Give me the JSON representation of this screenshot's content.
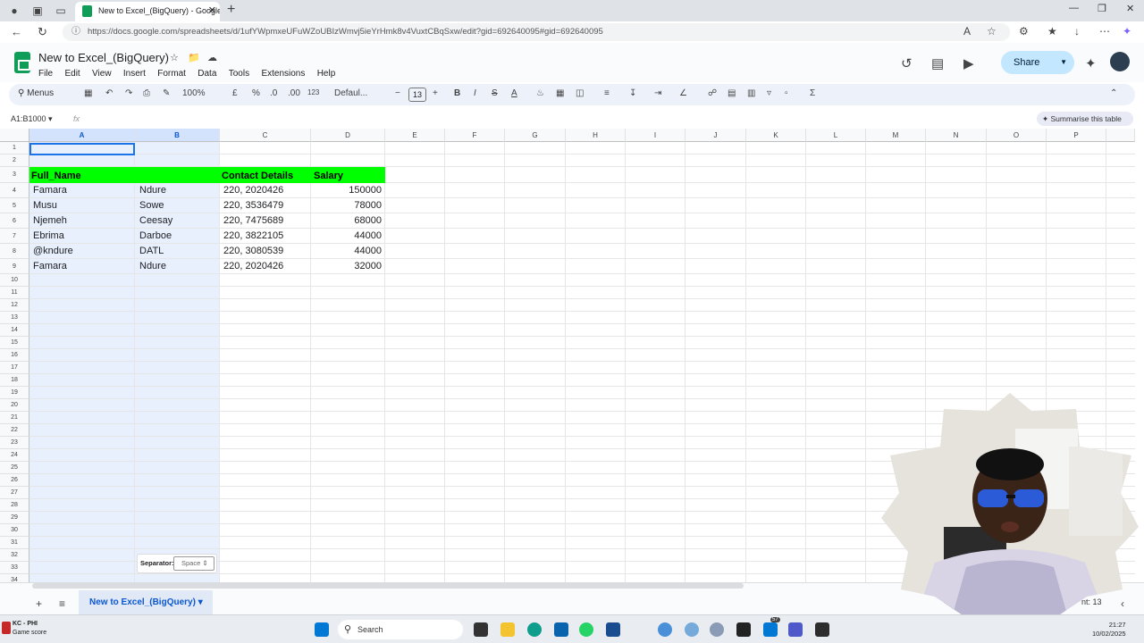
{
  "browser": {
    "tab_title": "New to Excel_(BigQuery) - Google",
    "url": "https://docs.google.com/spreadsheets/d/1ufYWpmxeUFuWZoUBIzWmvj5ieYrHmk8v4VuxtCBqSxw/edit?gid=692640095#gid=692640095"
  },
  "doc": {
    "title": "New to Excel_(BigQuery)",
    "menus": [
      "File",
      "Edit",
      "View",
      "Insert",
      "Format",
      "Data",
      "Tools",
      "Extensions",
      "Help"
    ],
    "share_label": "Share"
  },
  "toolbar": {
    "menus_label": "Menus",
    "zoom": "100%",
    "currency": "£",
    "percent": "%",
    "dec_dec": ".0",
    "dec_inc": ".00",
    "number_format": "123",
    "font": "Defaul...",
    "font_size": "13"
  },
  "formula_bar": {
    "name_box": "A1:B1000",
    "fx": "fx",
    "summarise": "Summarise this table"
  },
  "grid": {
    "columns": [
      "A",
      "B",
      "C",
      "D",
      "E",
      "F",
      "G",
      "H",
      "I",
      "J",
      "K",
      "L",
      "M",
      "N",
      "O",
      "P"
    ],
    "rows": [
      "1",
      "2",
      "3",
      "4",
      "5",
      "6",
      "7",
      "8",
      "9",
      "10",
      "11",
      "12",
      "13",
      "14",
      "15",
      "16",
      "17",
      "18",
      "19",
      "20",
      "21",
      "22",
      "23",
      "24",
      "25",
      "26",
      "27",
      "28",
      "29",
      "30",
      "31",
      "32",
      "33",
      "34"
    ],
    "headers": [
      "Full_Name",
      "Contact Details",
      "Salary"
    ],
    "data": [
      [
        "Famara",
        "Ndure",
        "220, 2020426",
        "150000"
      ],
      [
        "Musu",
        "Sowe",
        "220, 3536479",
        "78000"
      ],
      [
        "Njemeh",
        "Ceesay",
        "220, 7475689",
        "68000"
      ],
      [
        "Ebrima",
        "Darboe",
        "220, 3822105",
        "44000"
      ],
      [
        "@kndure",
        "DATL",
        "220, 3080539",
        "44000"
      ],
      [
        "Famara",
        "Ndure",
        "220, 2020426",
        "32000"
      ]
    ],
    "separator_label": "Separator:",
    "separator_value": "Space"
  },
  "sheet_tabs": {
    "active": "New to Excel_(BigQuery)",
    "count_label": "nt: 13"
  },
  "taskbar": {
    "kc_line1": "KC - PHI",
    "kc_line2": "Game score",
    "search": "Search",
    "badge": "57",
    "time": "21:27",
    "date": "10/02/2025"
  }
}
